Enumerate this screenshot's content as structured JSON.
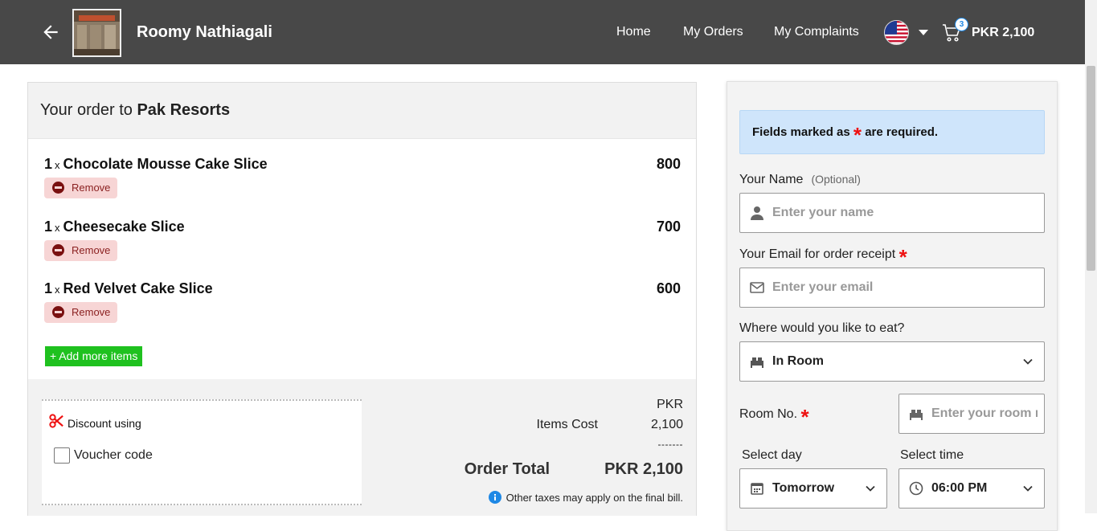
{
  "header": {
    "back_label": "Back",
    "brand": "Roomy Nathiagali",
    "nav": [
      "Home",
      "My Orders",
      "My Complaints"
    ],
    "cart_count": "3",
    "cart_total": "PKR 2,100",
    "colors": {
      "bar": "#484848"
    }
  },
  "order": {
    "title_prefix": "Your order to",
    "restaurant": "Pak Resorts",
    "items": [
      {
        "qty": "1",
        "x": "x",
        "name": "Chocolate Mousse Cake Slice",
        "price": "800",
        "remove": "Remove"
      },
      {
        "qty": "1",
        "x": "x",
        "name": "Cheesecake Slice",
        "price": "700",
        "remove": "Remove"
      },
      {
        "qty": "1",
        "x": "x",
        "name": "Red Velvet Cake Slice",
        "price": "600",
        "remove": "Remove"
      }
    ],
    "add_more": "+ Add more items",
    "discount_label": "Discount using",
    "voucher_label": "Voucher code",
    "currency": "PKR",
    "items_cost_label": "Items Cost",
    "items_cost": "2,100",
    "divider": "-------",
    "total_label": "Order Total",
    "total": "PKR 2,100",
    "tax_note": "Other taxes may apply on the final bill."
  },
  "form": {
    "notice_prefix": "Fields marked as",
    "notice_suffix": "are required.",
    "name_label": "Your Name",
    "name_optional": "(Optional)",
    "name_placeholder": "Enter your name",
    "email_label": "Your Email for order receipt",
    "email_placeholder": "Enter your email",
    "eat_label": "Where would you like to eat?",
    "eat_value": "In Room",
    "room_label": "Room No.",
    "room_placeholder": "Enter your room n",
    "day_label": "Select day",
    "day_value": "Tomorrow",
    "time_label": "Select time",
    "time_value": "06:00 PM"
  }
}
